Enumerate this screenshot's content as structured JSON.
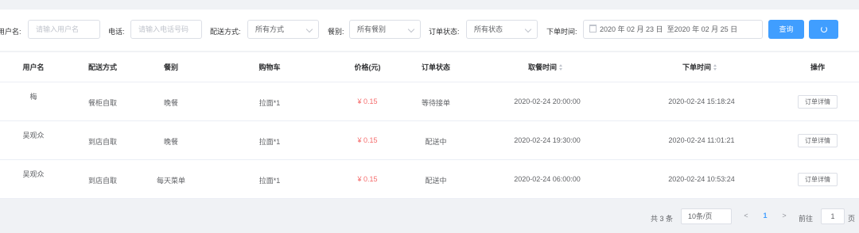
{
  "filters": {
    "username_label": "用户名:",
    "username_placeholder": "请输入用户名",
    "phone_label": "电话:",
    "phone_placeholder": "请输入电话号码",
    "delivery_label": "配送方式:",
    "delivery_value": "所有方式",
    "meal_label": "餐别:",
    "meal_value": "所有餐别",
    "status_label": "订单状态:",
    "status_value": "所有状态",
    "time_label": "下单时间:",
    "date_start": "2020 年 02 月 23 日",
    "date_sep": "至",
    "date_end": "2020 年 02 月 25 日",
    "query_button": "查询"
  },
  "table": {
    "columns": [
      "用户名",
      "配送方式",
      "餐别",
      "购物车",
      "价格(元)",
      "订单状态",
      "取餐时间",
      "下单时间",
      "操作"
    ],
    "rows": [
      {
        "user": "梅",
        "delivery": "餐柜自取",
        "meal": "晚餐",
        "cart": "拉面*1",
        "price": "¥ 0.15",
        "status": "等待接单",
        "pickup": "2020-02-24 20:00:00",
        "ordered": "2020-02-24 15:18:24",
        "action": "订单详情"
      },
      {
        "user": "吴观众",
        "delivery": "到店自取",
        "meal": "晚餐",
        "cart": "拉面*1",
        "price": "¥ 0.15",
        "status": "配送中",
        "pickup": "2020-02-24 19:30:00",
        "ordered": "2020-02-24 11:01:21",
        "action": "订单详情"
      },
      {
        "user": "吴观众",
        "delivery": "到店自取",
        "meal": "每天菜单",
        "cart": "拉面*1",
        "price": "¥ 0.15",
        "status": "配送中",
        "pickup": "2020-02-24 06:00:00",
        "ordered": "2020-02-24 10:53:24",
        "action": "订单详情"
      }
    ]
  },
  "pagination": {
    "total": "共 3 条",
    "page_size": "10条/页",
    "prev": "<",
    "page": "1",
    "next": ">",
    "goto_prefix": "前往",
    "goto_value": "1",
    "goto_suffix": "页"
  },
  "colors": {
    "accent": "#409eff",
    "price": "#f56c6c"
  }
}
